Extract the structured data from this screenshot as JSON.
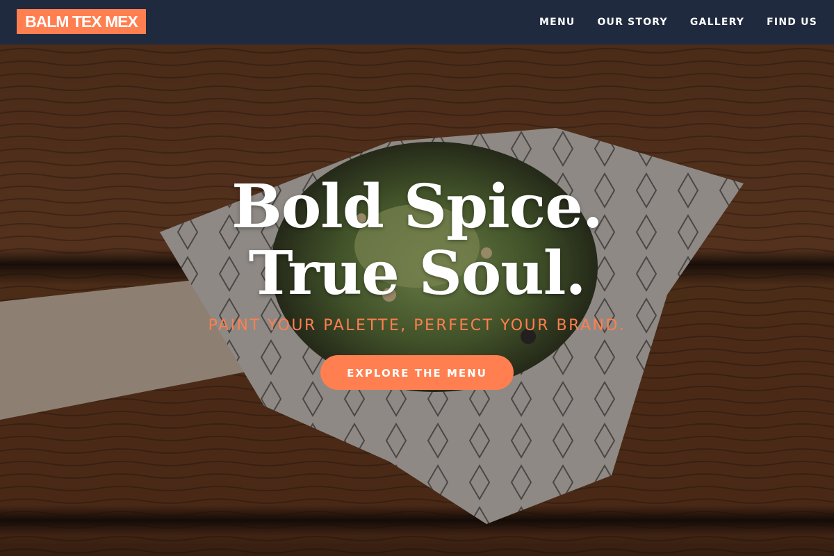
{
  "brand": {
    "name": "BALM TEX MEX",
    "accent": "#ff7f50",
    "nav_bg": "#1f2a3e"
  },
  "nav": {
    "items": [
      {
        "label": "MENU"
      },
      {
        "label": "OUR STORY"
      },
      {
        "label": "GALLERY"
      },
      {
        "label": "FIND US"
      }
    ]
  },
  "hero": {
    "headline_line1": "Bold Spice.",
    "headline_line2": "True Soul.",
    "tagline": "PAINT YOUR PALETTE, PERFECT YOUR BRAND.",
    "cta_label": "EXPLORE THE MENU",
    "background_icon": "food-bowl-photo"
  }
}
